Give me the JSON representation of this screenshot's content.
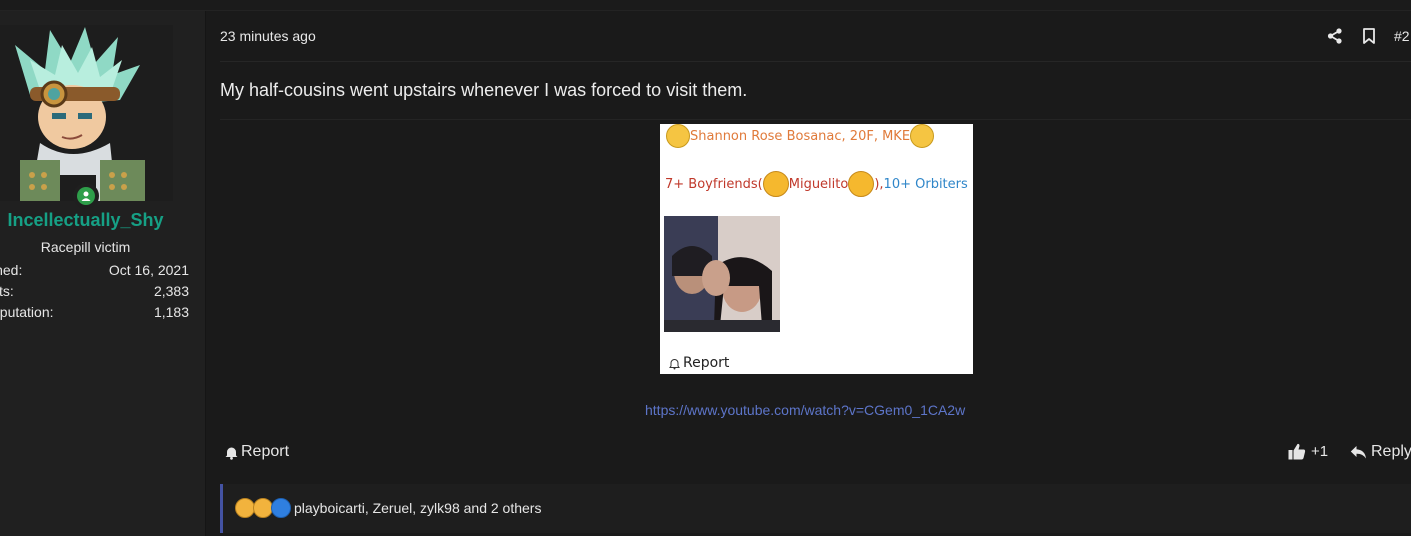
{
  "post": {
    "time": "23 minutes ago",
    "number": "#2",
    "body": "My half-cousins went upstairs whenever I was forced to visit them.",
    "link": "https://www.youtube.com/watch?v=CGem0_1CA2w",
    "report_label": "Report",
    "react_count": "+1",
    "reply_label": "Reply",
    "reactions_text": "playboicarti, Zeruel, zylk98 and 2 others"
  },
  "user": {
    "name": "Incellectually_Shy",
    "title": "Racepill victim",
    "stats": [
      {
        "label": "ined:",
        "value": "Oct 16, 2021"
      },
      {
        "label": "sts:",
        "value": "2,383"
      },
      {
        "label": "eputation:",
        "value": "1,183"
      }
    ]
  },
  "embed": {
    "line1": "Shannon Rose Bosanac, 20F, MKE",
    "line2_part1": "7+ Boyfriends(",
    "line2_part2": " Miguelito",
    "line2_part3": "), ",
    "line2_part4": "10+ Orbiters",
    "report_label": "Report"
  },
  "colors": {
    "username": "#16a085",
    "link": "#5d75c9",
    "reactions_accent": "#4453a3",
    "embed_orange": "#e07a3a",
    "embed_red": "#c0392b",
    "embed_blue": "#2f86c9"
  },
  "icons": [
    "share-icon",
    "bookmark-icon",
    "bell-icon",
    "thumbs-up-icon",
    "reply-icon",
    "online-status-icon"
  ]
}
